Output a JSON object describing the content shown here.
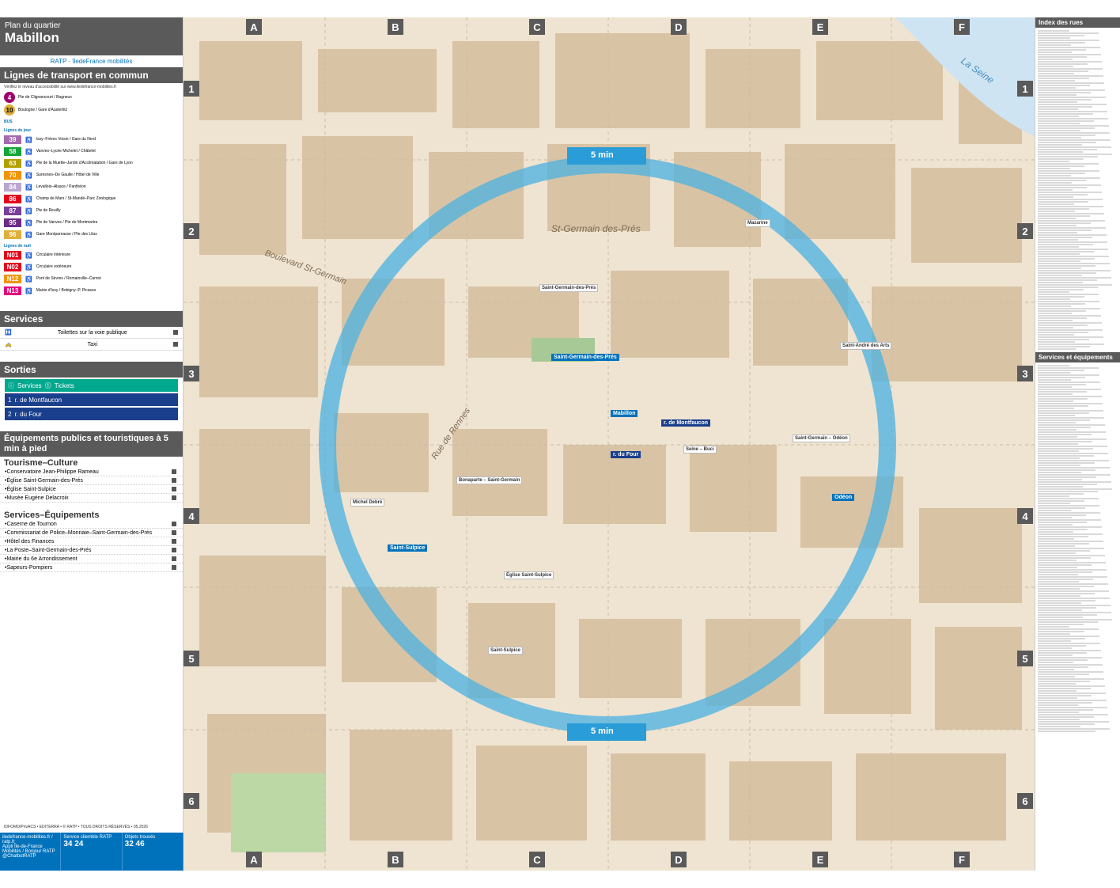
{
  "header": {
    "small": "Plan du quartier",
    "title": "Mabillon",
    "logo_text": "RATP · îledeFrance mobilités"
  },
  "transport": {
    "title": "Lignes de transport en commun",
    "access_note": "Vérifiez le niveau d'accessibilité sur www.iledefrance-mobilites.fr",
    "metro": [
      {
        "line": "4",
        "color": "#a0006e",
        "text_color": "#fff",
        "desc": "Pte de Clignancourt / Bagneux"
      },
      {
        "line": "10",
        "color": "#dfb039",
        "text_color": "#000",
        "desc": "Boulogne / Gare d'Austerlitz"
      }
    ],
    "bus_label": "BUS",
    "day_label": "Lignes de jour",
    "bus_day": [
      {
        "line": "39",
        "color": "#a36aae",
        "desc": "Issy–Frères Voisin / Gare du Nord"
      },
      {
        "line": "58",
        "color": "#13a538",
        "desc": "Vanves–Lycée Michelet / Châtelet"
      },
      {
        "line": "63",
        "color": "#b3a000",
        "desc": "Pte de la Muette–Jardin d'Acclimatation / Gare de Lyon"
      },
      {
        "line": "70",
        "color": "#f29400",
        "desc": "Suresnes–De Gaulle / Hôtel de Ville"
      },
      {
        "line": "84",
        "color": "#bba6d0",
        "desc": "Levallois–Alsace / Panthéon"
      },
      {
        "line": "86",
        "color": "#e3051b",
        "desc": "Champ de Mars / St-Mandé–Parc Zoologique"
      },
      {
        "line": "87",
        "color": "#7a3f98",
        "desc": "Pte de Reuilly"
      },
      {
        "line": "95",
        "color": "#6d2c86",
        "desc": "Pte de Vanves / Pte de Montmartre"
      },
      {
        "line": "96",
        "color": "#dfb039",
        "desc": "Gare Montparnasse / Pte des Lilas"
      }
    ],
    "night_label": "Lignes de nuit",
    "bus_night": [
      {
        "line": "N01",
        "color": "#e3051b",
        "desc": "Circulaire intérieure"
      },
      {
        "line": "N02",
        "color": "#e3051b",
        "desc": "Circulaire extérieure"
      },
      {
        "line": "N12",
        "color": "#f29400",
        "desc": "Pont de Sèvres / Romainville–Carnot"
      },
      {
        "line": "N13",
        "color": "#e6007e",
        "desc": "Mairie d'Issy / Bobigny–P. Picasso"
      }
    ]
  },
  "services": {
    "title": "Services",
    "items": [
      {
        "label": "Toilettes sur la voie publique"
      },
      {
        "label": "Taxi"
      }
    ]
  },
  "exits": {
    "title": "Sorties",
    "services_label": "Services",
    "tickets_label": "Tickets",
    "items": [
      {
        "num": "1",
        "label": "r. de Montfaucon"
      },
      {
        "num": "2",
        "label": "r. du Four"
      }
    ]
  },
  "poi": {
    "title": "Équipements publics et touristiques à 5 min à pied",
    "tourism_title": "Tourisme–Culture",
    "tourism": [
      "Conservatoire Jean-Philippe Rameau",
      "Église Saint-Germain-des-Prés",
      "Église Saint-Sulpice",
      "Musée Eugène Delacroix"
    ],
    "services_title": "Services–Équipements",
    "services": [
      "Caserne de Tournon",
      "Commissariat de Police–Monnaie–Saint-Germain-des-Prés",
      "Hôtel des Finances",
      "La Poste–Saint-Germain-des-Prés",
      "Mairie du 6e Arrondissement",
      "Sapeurs-Pompiers"
    ]
  },
  "footer": {
    "web": "iledefrance-mobilites.fr / ratp.fr",
    "app": "Appli Île-de-France Mobilités / Bonjour RATP",
    "twitter": "@ChatbotRATP",
    "service_label": "Service clientèle RATP",
    "service_num": "34 24",
    "lost_label": "Objets trouvés",
    "lost_num": "32 46"
  },
  "credits": "IDFOMO/PrivACS • EDITERRA • © RATP • TOUS DROITS RÉSERVÉS • 05.2026",
  "code": "AQM_MABILLON",
  "map": {
    "columns": [
      "A",
      "B",
      "C",
      "D",
      "E",
      "F"
    ],
    "rows": [
      "1",
      "2",
      "3",
      "4",
      "5",
      "6"
    ],
    "walk_label": "5 min",
    "station_mabillon": "Mabillon",
    "station_sgdp": "Saint-Germain-des-Prés",
    "station_odeon": "Odéon",
    "station_sulpice": "Saint-Sulpice",
    "exit_montfaucon": "r. de Montfaucon",
    "exit_four": "r. du Four",
    "district": "St-Germain des-Prés",
    "street_sg": "Boulevard St-Germain",
    "street_rennes": "Rue de Rennes",
    "seine": "La Seine",
    "stops": [
      "Mazarine",
      "Saint-André des Arts",
      "Saint-Germain – Odéon",
      "Seine – Buci",
      "Bonaparte – Saint-Germain",
      "Michel Debré",
      "Église Saint-Sulpice",
      "Saint-Sulpice",
      "Saint-Germain-des-Prés"
    ]
  },
  "index": {
    "title": "Index des rues",
    "services_title": "Services et équipements"
  }
}
